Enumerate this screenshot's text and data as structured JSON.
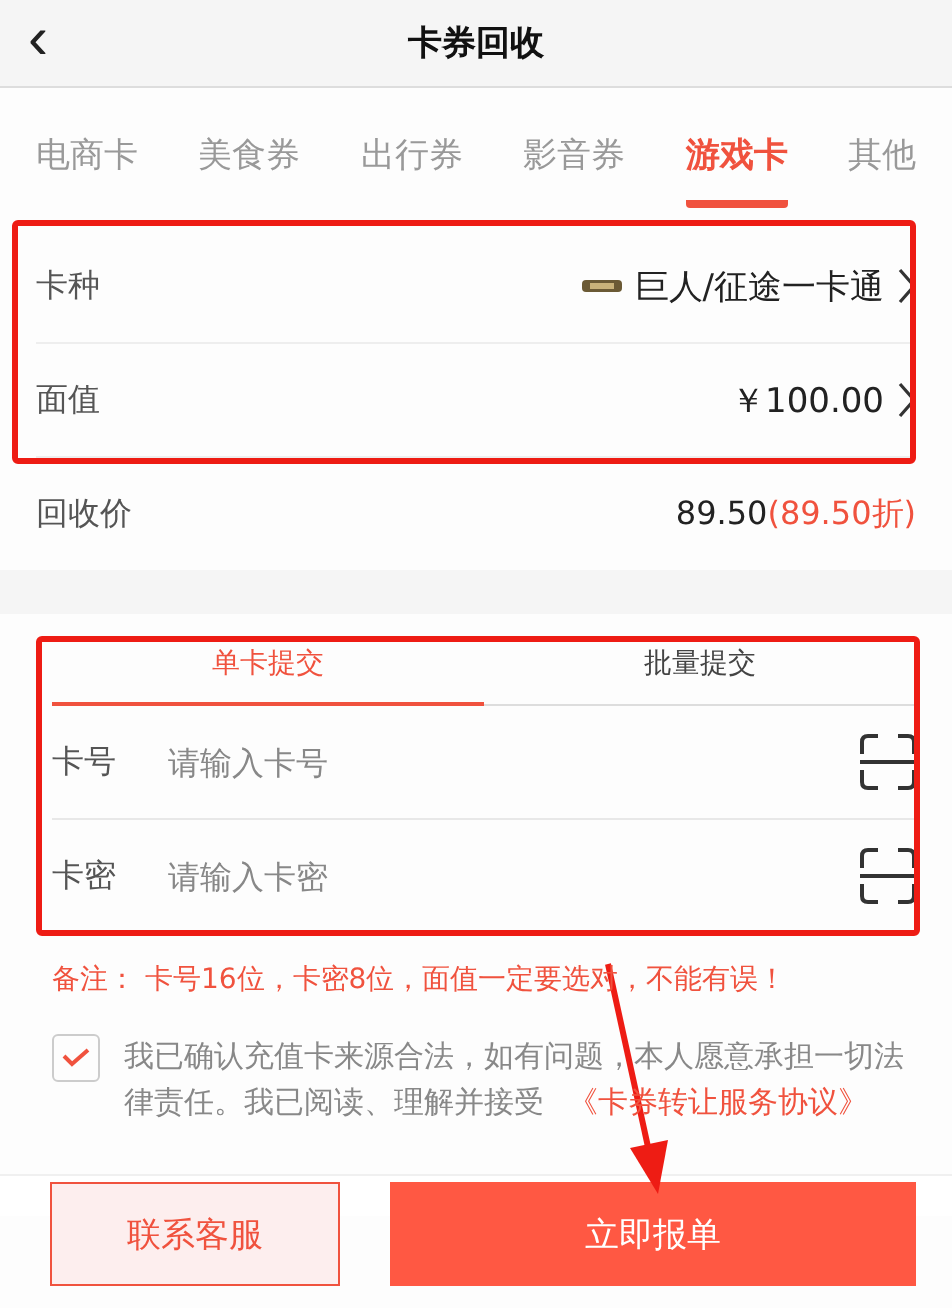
{
  "header": {
    "back": "‹",
    "title": "卡券回收"
  },
  "categories": [
    {
      "label": "电商卡",
      "selected": false
    },
    {
      "label": "美食券",
      "selected": false
    },
    {
      "label": "出行券",
      "selected": false
    },
    {
      "label": "影音券",
      "selected": false
    },
    {
      "label": "游戏卡",
      "selected": true
    },
    {
      "label": "其他",
      "selected": false
    }
  ],
  "card_info": {
    "highlighted": true,
    "rows": [
      {
        "label": "卡种",
        "value": "巨人/征途一卡通",
        "logo": true
      },
      {
        "label": "面值",
        "value": "￥100.00"
      }
    ]
  },
  "price": {
    "label": "回收价",
    "value": "89.50",
    "discount": "(89.50折)"
  },
  "submit": {
    "highlighted": true,
    "tabs": [
      {
        "label": "单卡提交",
        "selected": true
      },
      {
        "label": "批量提交",
        "selected": false
      }
    ],
    "fields": [
      {
        "label": "卡号",
        "placeholder": "请输入卡号"
      },
      {
        "label": "卡密",
        "placeholder": "请输入卡密"
      }
    ]
  },
  "note": "备注： 卡号16位，卡密8位，面值一定要选对，不能有误！",
  "agreement": {
    "checked": true,
    "text": "我已确认充值卡来源合法，如有问题，本人愿意承担一切法律责任。我已阅读、理解并接受",
    "link": "《卡券转让服务协议》"
  },
  "buttons": {
    "contact": "联系客服",
    "submit": "立即报单"
  },
  "pointer_arrow": true
}
